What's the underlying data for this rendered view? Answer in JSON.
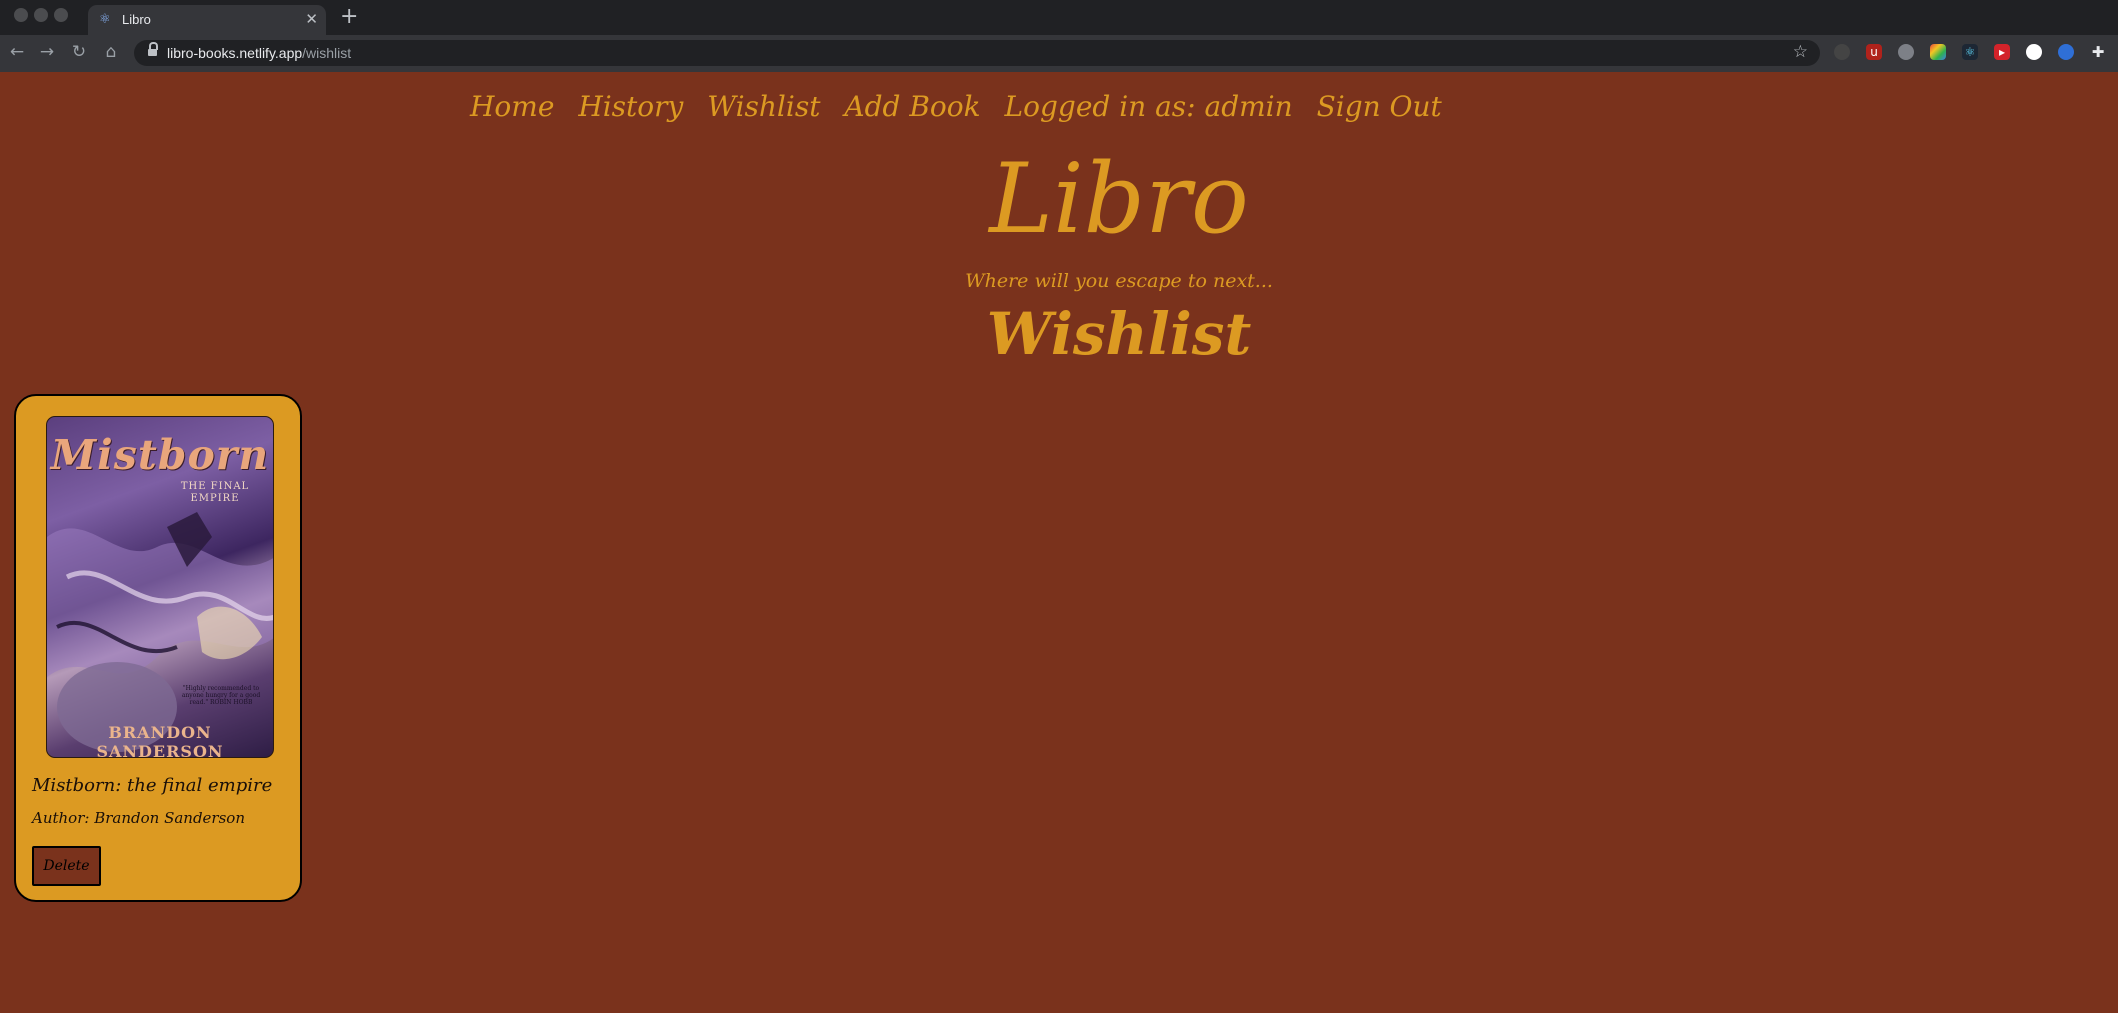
{
  "browser": {
    "tab_title": "Libro",
    "url_host": "libro-books.netlify.app",
    "url_path": "/wishlist"
  },
  "nav": {
    "home": "Home",
    "history": "History",
    "wishlist": "Wishlist",
    "add_book": "Add Book",
    "logged_in": "Logged in as: admin",
    "sign_out": "Sign Out"
  },
  "header": {
    "brand": "Libro",
    "tagline": "Where will you escape to next...",
    "page_heading": "Wishlist"
  },
  "books": [
    {
      "cover_title": "Mistborn",
      "cover_subtitle": "THE FINAL EMPIRE",
      "cover_quote": "\"Highly recommended to anyone hungry for a good read.\" ROBIN HOBB",
      "cover_author": "BRANDON SANDERSON",
      "title": "Mistborn: the final empire",
      "author_line": "Author: Brandon Sanderson",
      "delete_label": "Delete"
    }
  ],
  "colors": {
    "page_background": "#7a321c",
    "accent": "#dc9a22"
  }
}
